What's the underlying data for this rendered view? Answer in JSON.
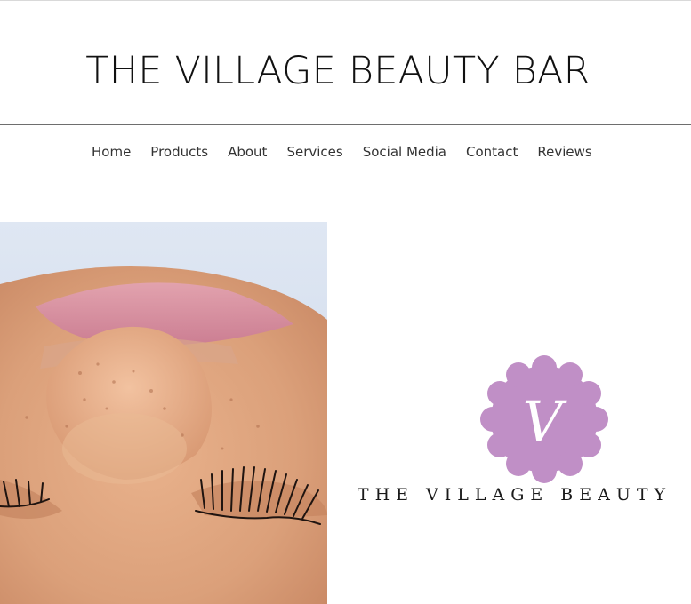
{
  "site": {
    "title": "THE VILLAGE BEAUTY BAR"
  },
  "nav": {
    "items": [
      {
        "label": "Home"
      },
      {
        "label": "Products"
      },
      {
        "label": "About"
      },
      {
        "label": "Services"
      },
      {
        "label": "Social Media"
      },
      {
        "label": "Contact"
      },
      {
        "label": "Reviews"
      }
    ]
  },
  "logo": {
    "monogram": "V",
    "wordmark": "THE VILLAGE BEAUTY",
    "badge_color": "#c08fc6"
  },
  "colors": {
    "text": "#111111",
    "nav_text": "#333333",
    "divider": "#6e6e6e"
  }
}
